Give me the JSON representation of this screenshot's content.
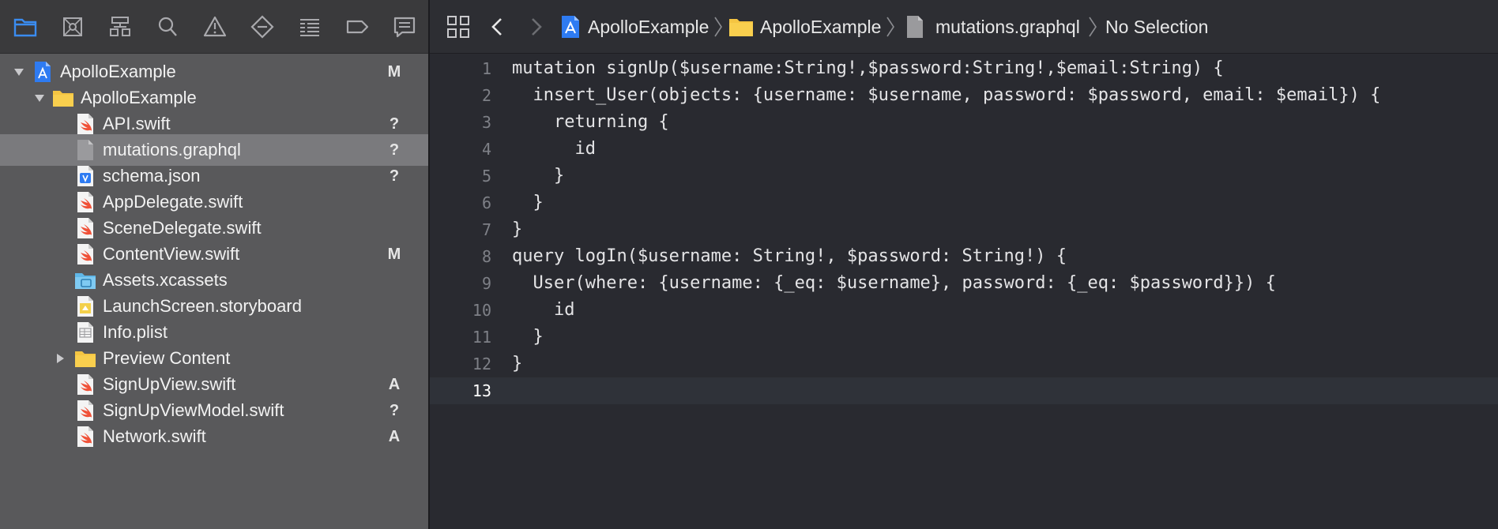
{
  "navigator": {
    "toolbar_icons": [
      "project-navigator-icon",
      "source-control-navigator-icon",
      "symbol-navigator-icon",
      "find-navigator-icon",
      "issue-navigator-icon",
      "test-navigator-icon",
      "debug-navigator-icon",
      "breakpoint-navigator-icon",
      "report-navigator-icon"
    ],
    "files": [
      {
        "name": "ApolloExample",
        "status": "M",
        "icon": "xcode-project-icon",
        "disclosure": "expanded"
      },
      {
        "name": "ApolloExample",
        "status": "",
        "icon": "folder-icon",
        "disclosure": "expanded"
      },
      {
        "name": "API.swift",
        "status": "?",
        "icon": "swift-file-icon"
      },
      {
        "name": "mutations.graphql",
        "status": "?",
        "icon": "generic-file-icon",
        "selected": true
      },
      {
        "name": "schema.json",
        "status": "?",
        "icon": "json-file-icon"
      },
      {
        "name": "AppDelegate.swift",
        "status": "",
        "icon": "swift-file-icon"
      },
      {
        "name": "SceneDelegate.swift",
        "status": "",
        "icon": "swift-file-icon"
      },
      {
        "name": "ContentView.swift",
        "status": "M",
        "icon": "swift-file-icon"
      },
      {
        "name": "Assets.xcassets",
        "status": "",
        "icon": "asset-catalog-icon"
      },
      {
        "name": "LaunchScreen.storyboard",
        "status": "",
        "icon": "storyboard-file-icon"
      },
      {
        "name": "Info.plist",
        "status": "",
        "icon": "plist-file-icon"
      },
      {
        "name": "Preview Content",
        "status": "",
        "icon": "folder-icon",
        "disclosure": "collapsed"
      },
      {
        "name": "SignUpView.swift",
        "status": "A",
        "icon": "swift-file-icon"
      },
      {
        "name": "SignUpViewModel.swift",
        "status": "?",
        "icon": "swift-file-icon"
      },
      {
        "name": "Network.swift",
        "status": "A",
        "icon": "swift-file-icon"
      }
    ]
  },
  "jumpbar": {
    "project": "ApolloExample",
    "group": "ApolloExample",
    "file": "mutations.graphql",
    "selection": "No Selection"
  },
  "editor": {
    "current_line": 13,
    "lines": [
      {
        "n": "1",
        "text": "mutation signUp($username:String!,$password:String!,$email:String) {"
      },
      {
        "n": "2",
        "text": "  insert_User(objects: {username: $username, password: $password, email: $email}) {"
      },
      {
        "n": "3",
        "text": "    returning {"
      },
      {
        "n": "4",
        "text": "      id"
      },
      {
        "n": "5",
        "text": "    }"
      },
      {
        "n": "6",
        "text": "  }"
      },
      {
        "n": "7",
        "text": "}"
      },
      {
        "n": "8",
        "text": "query logIn($username: String!, $password: String!) {"
      },
      {
        "n": "9",
        "text": "  User(where: {username: {_eq: $username}, password: {_eq: $password}}) {"
      },
      {
        "n": "10",
        "text": "    id"
      },
      {
        "n": "11",
        "text": "  }"
      },
      {
        "n": "12",
        "text": "}"
      },
      {
        "n": "13",
        "text": ""
      }
    ]
  },
  "colors": {
    "navigator_bg": "#59595b",
    "selected_row": "#7a7a7d",
    "editor_bg": "#292a30",
    "accent_blue": "#3a8cf0",
    "folder_yellow": "#f5c542"
  }
}
